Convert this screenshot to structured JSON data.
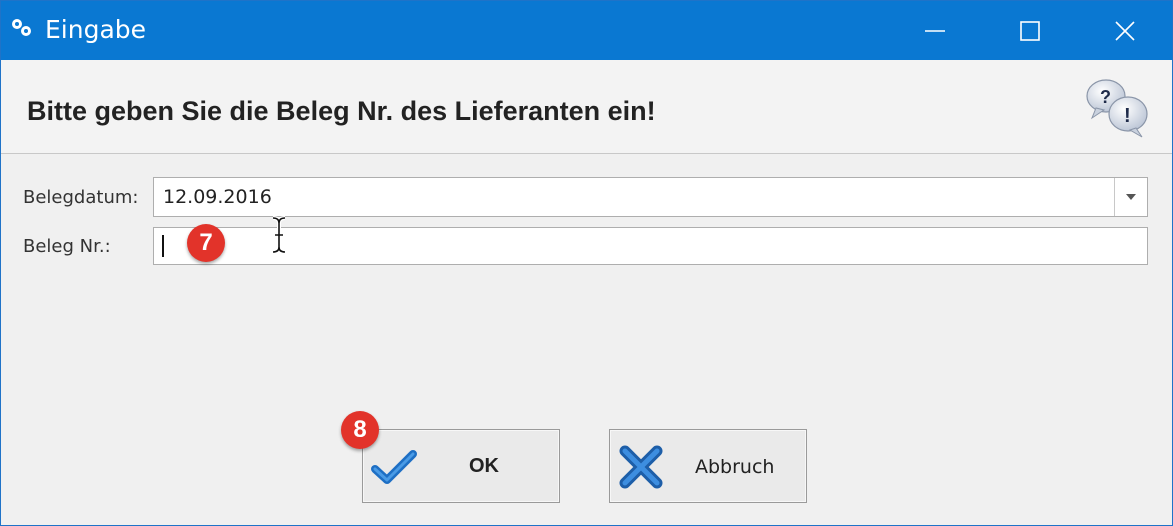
{
  "window": {
    "title": "Eingabe",
    "title_bar_color": "#0a78d2"
  },
  "header": {
    "title": "Bitte geben Sie die Beleg Nr. des Lieferanten ein!",
    "icon": "help-question-icon"
  },
  "form": {
    "belegdatum": {
      "label": "Belegdatum:",
      "value": "12.09.2016"
    },
    "beleg_nr": {
      "label": "Beleg Nr.:",
      "value": ""
    }
  },
  "badges": {
    "step_7": "7",
    "step_8": "8",
    "color": "#e2332a"
  },
  "buttons": {
    "ok_label": "OK",
    "cancel_label": "Abbruch",
    "ok_icon": "checkmark-icon",
    "cancel_icon": "cross-icon"
  }
}
